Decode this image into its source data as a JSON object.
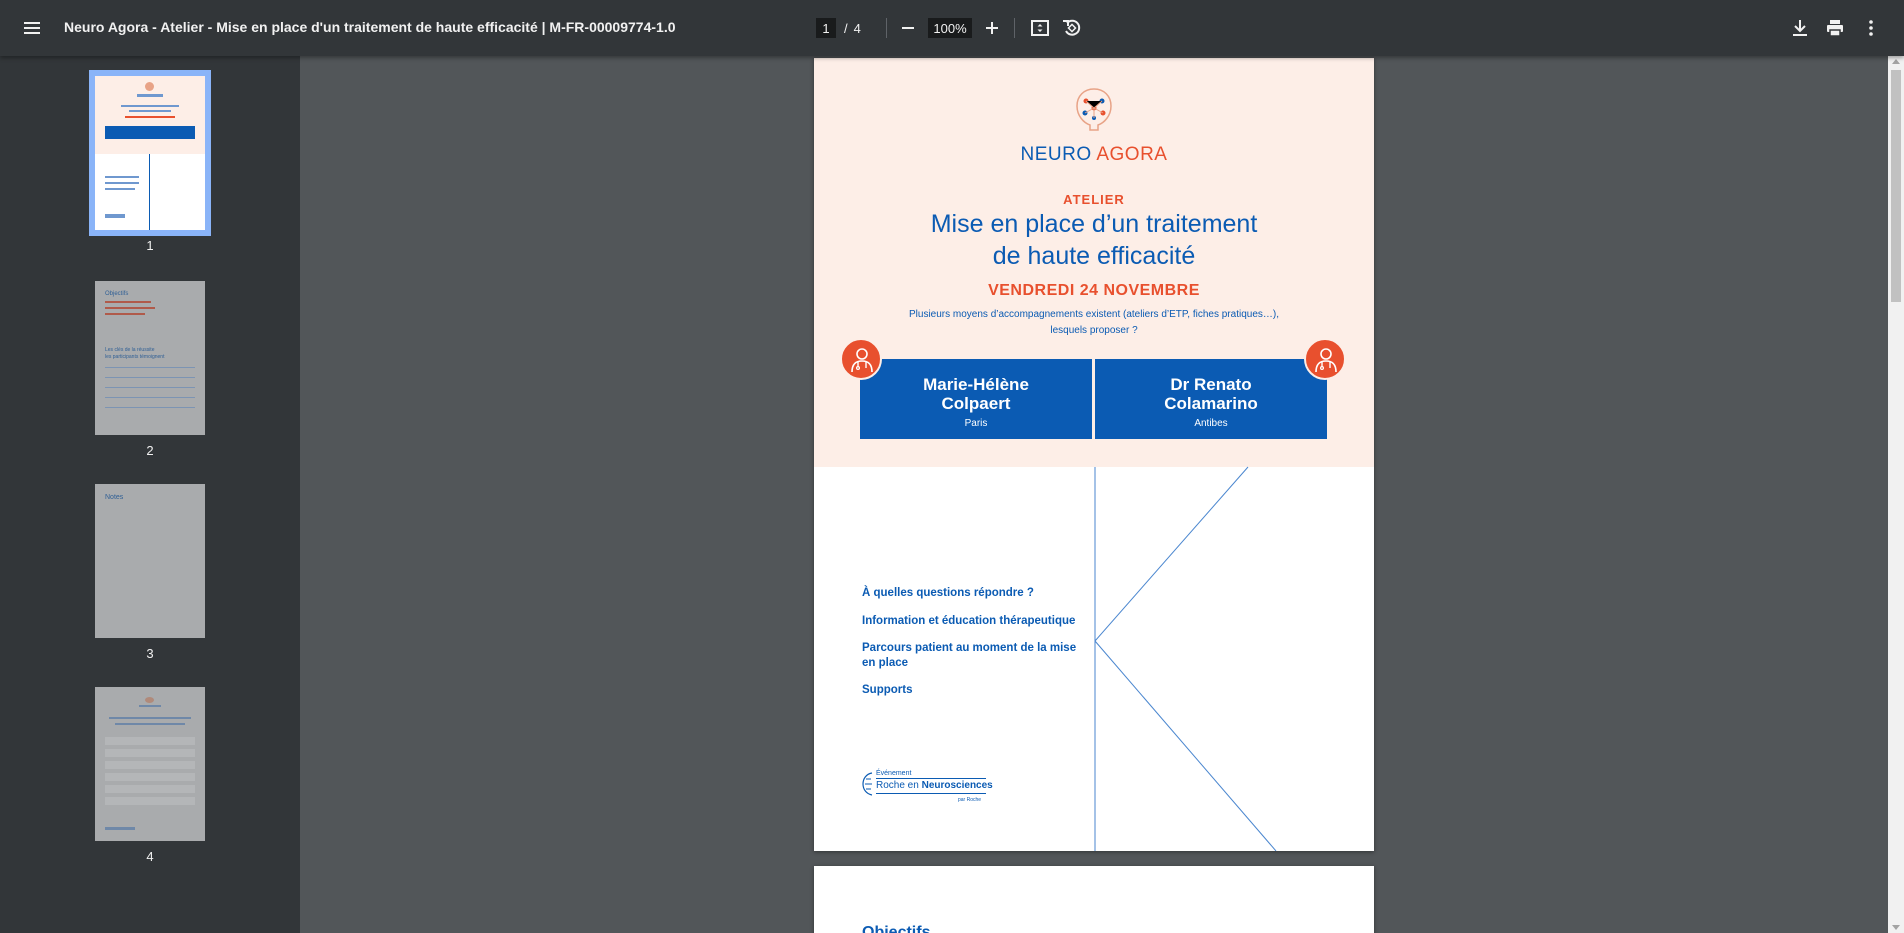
{
  "toolbar": {
    "title": "Neuro Agora - Atelier - Mise en place d'un traitement de haute efficacité | M-FR-00009774-1.0",
    "current_page": "1",
    "page_separator": "/",
    "total_pages": "4",
    "zoom": "100%",
    "icons": [
      "menu-icon",
      "zoom-out-icon",
      "zoom-in-icon",
      "fit-page-icon",
      "rotate-icon",
      "download-icon",
      "print-icon",
      "more-vert-icon"
    ]
  },
  "sidebar": {
    "thumbnails": [
      {
        "label": "1",
        "active": true
      },
      {
        "label": "2",
        "active": false
      },
      {
        "label": "3",
        "active": false
      },
      {
        "label": "4",
        "active": false
      }
    ],
    "thumb3_text": "Notes",
    "thumb2_text1": "Objectifs",
    "thumb2_text2": "Les clés de la réussite",
    "thumb2_text3": "les participants témoignent"
  },
  "document": {
    "brand_part1": "NEURO ",
    "brand_part2": "AGORA",
    "kicker": "ATELIER",
    "title_line1": "Mise en place d’un traitement",
    "title_line2": "de haute efficacité",
    "date": "VENDREDI 24 NOVEMBRE",
    "intro_line1": "Plusieurs moyens d’accompagnements existent  (ateliers d’ETP, fiches pratiques…),",
    "intro_line2": "lesquels proposer ?",
    "speakers": [
      {
        "name_line1": "Marie-Hélène",
        "name_line2": "Colpaert",
        "city": "Paris"
      },
      {
        "name_line1": "Dr Renato",
        "name_line2": "Colamarino",
        "city": "Antibes"
      }
    ],
    "topics": [
      "À quelles questions répondre ?",
      "Information et éducation thérapeutique",
      "Parcours patient au moment de la mise en place",
      "Supports"
    ],
    "sponsor_event": "Événement",
    "sponsor_prefix": "Roche en ",
    "sponsor_bold": "Neurosciences",
    "sponsor_by": "par Roche",
    "page2_heading": "Objectifs"
  },
  "colors": {
    "toolbar_bg": "#323639",
    "viewer_bg": "#525659",
    "accent_blue": "#0b5bb3",
    "accent_orange": "#e8502e",
    "hero_bg": "#fdeee7",
    "active_thumb_outline": "#8ab4f8"
  }
}
